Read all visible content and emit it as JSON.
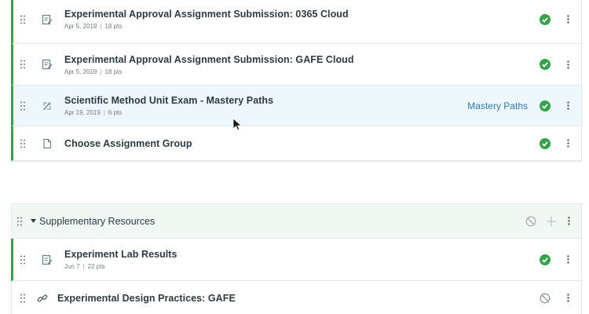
{
  "modules": [
    {
      "items": [
        {
          "type": "assignment",
          "title": "Experimental Approval Assignment Submission: 0365 Cloud",
          "date": "Apr 5, 2019",
          "points": "18 pts",
          "published": true
        },
        {
          "type": "assignment",
          "title": "Experimental Approval Assignment Submission: GAFE Cloud",
          "date": "Apr 5, 2019",
          "points": "18 pts",
          "published": true
        },
        {
          "type": "quiz",
          "title": "Scientific Method Unit Exam - Mastery Paths",
          "date": "Apr 19, 2019",
          "points": "6 pts",
          "published": true,
          "mastery_label": "Mastery Paths"
        },
        {
          "type": "page",
          "title": "Choose Assignment Group",
          "published": true
        }
      ]
    },
    {
      "title": "Supplementary Resources",
      "items": [
        {
          "type": "assignment",
          "title": "Experiment Lab Results",
          "date": "Jun 7",
          "points": "22 pts",
          "published": true
        },
        {
          "type": "link",
          "title": "Experimental Design Practices: GAFE",
          "published": false
        }
      ]
    }
  ],
  "colors": {
    "published": "#36a34a",
    "link": "#2b7abc",
    "header_bg": "#f1f8f4",
    "hover_bg": "#eef7fb"
  },
  "icons": {
    "drag": "drag-handle-icon",
    "assignment": "assignment-icon",
    "quiz": "quiz-icon",
    "page": "page-icon",
    "link": "link-icon",
    "published": "published-check-icon",
    "unpublished": "unpublished-icon",
    "kebab": "kebab-menu-icon",
    "caret": "caret-down-icon",
    "add": "add-icon"
  }
}
